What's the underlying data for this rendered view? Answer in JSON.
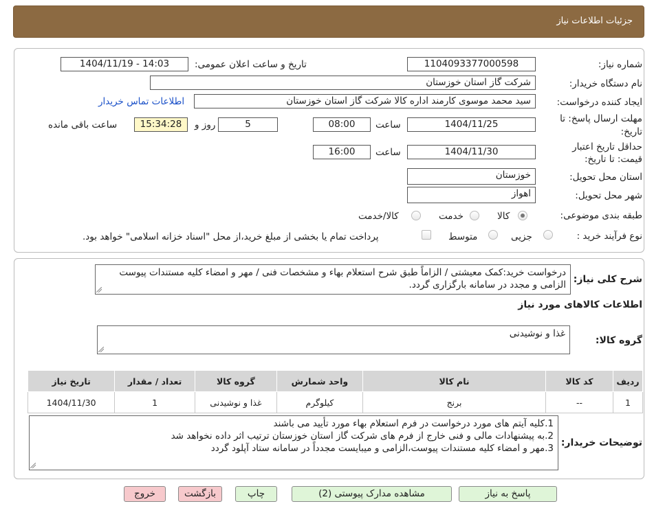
{
  "header": {
    "title": "جزئیات اطلاعات نیاز"
  },
  "form": {
    "need_number_label": "شماره نیاز:",
    "need_number": "1104093377000598",
    "announce_label": "تاریخ و ساعت اعلان عمومی:",
    "announce_value": "1404/11/19 - 14:03",
    "buyer_org_label": "نام دستگاه خریدار:",
    "buyer_org": "شرکت گاز استان خوزستان",
    "creator_label": "ایجاد کننده درخواست:",
    "creator": "سید محمد موسوی کارمند اداره کالا شرکت گاز استان خوزستان",
    "contact_link": "اطلاعات تماس خریدار",
    "reply_deadline_label_1": "مهلت ارسال پاسخ: تا",
    "reply_deadline_label_2": "تاریخ:",
    "reply_date": "1404/11/25",
    "time_label": "ساعت",
    "reply_time": "08:00",
    "days_value": "5",
    "days_label": "روز و",
    "remaining_time": "15:34:28",
    "remaining_label": "ساعت باقی مانده",
    "validity_label_1": "حداقل تاریخ اعتبار",
    "validity_label_2": "قیمت: تا تاریخ:",
    "validity_date": "1404/11/30",
    "validity_time_label": "ساعت",
    "validity_time": "16:00",
    "province_label": "استان محل تحویل:",
    "province": "خوزستان",
    "city_label": "شهر محل تحویل:",
    "city": "اهواز",
    "category_label": "طبقه بندی موضوعی:",
    "category_options": [
      "کالا",
      "خدمت",
      "کالا/خدمت"
    ],
    "category_selected": "کالا",
    "process_label": "نوع فرآیند خرید :",
    "process_options": [
      "جزیی",
      "متوسط"
    ],
    "payment_note": "پرداخت تمام یا بخشی از مبلغ خرید،از محل \"اسناد خزانه اسلامی\" خواهد بود."
  },
  "summary": {
    "label": "شرح کلی نیاز:",
    "text": "درخواست خرید:کمک معیشتی / الزاماً طبق شرح استعلام بهاء و مشخصات فنی / مهر و امضاء کلیه مستندات پیوست الزامی و مجدد در سامانه بارگزاری گردد."
  },
  "goods": {
    "section_title": "اطلاعات کالاهای مورد نیاز",
    "group_label": "گروه کالا:",
    "group_value": "غذا و نوشیدنی",
    "columns": [
      "ردیف",
      "کد کالا",
      "نام کالا",
      "واحد شمارش",
      "گروه کالا",
      "تعداد / مقدار",
      "تاریخ نیاز"
    ],
    "rows": [
      [
        "1",
        "--",
        "برنج",
        "کیلوگرم",
        "غذا و نوشیدنی",
        "1",
        "1404/11/30"
      ]
    ]
  },
  "buyer_notes": {
    "label": "توضیحات خریدار:",
    "lines": [
      "1.کلیه آیتم های مورد درخواست در فرم استعلام بهاء مورد تأیید می باشند",
      "2.به پیشنهادات مالی و فنی خارج از فرم های شرکت گاز استان خوزستان ترتیب اثر داده نخواهد شد",
      "3.مهر و امضاء کلیه مستندات پیوست،الزامی و میبایست مجدداً در سامانه ستاد آپلود گردد"
    ]
  },
  "buttons": {
    "reply": "پاسخ به نیاز",
    "attachments": "مشاهده مدارک پیوستی (2)",
    "print": "چاپ",
    "back": "بازگشت",
    "exit": "خروج"
  },
  "colors": {
    "header": "#8c6a42",
    "time_highlight": "#fff8c8",
    "green_button": "#dff5d8",
    "red_button": "#f7c9cc"
  }
}
